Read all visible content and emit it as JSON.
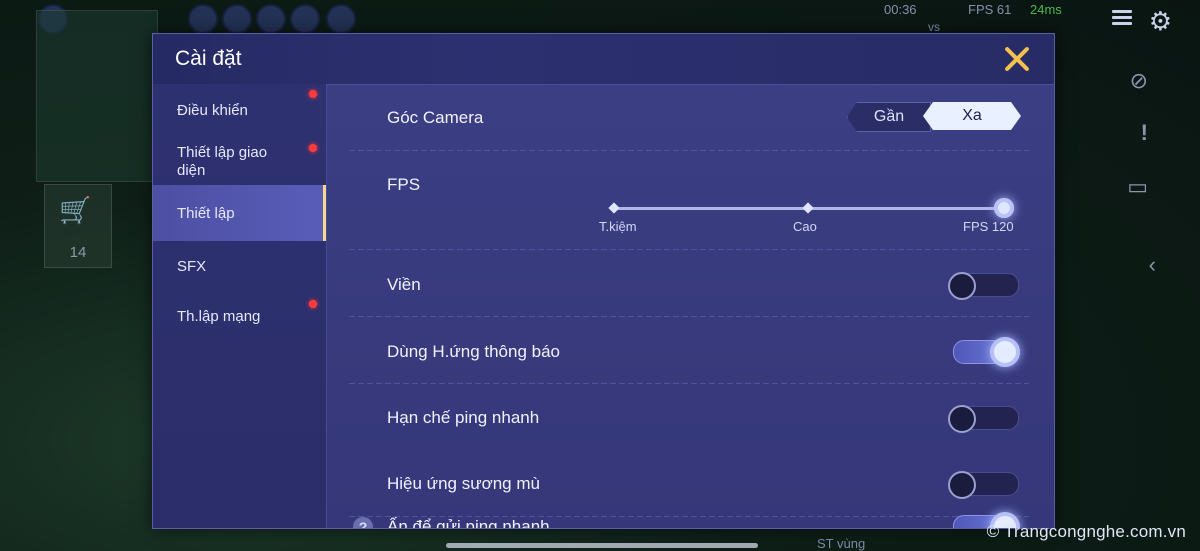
{
  "hud": {
    "timer": "00:36",
    "fps_label": "FPS 61",
    "ping": "24ms",
    "vs": "vs"
  },
  "shop": {
    "count": "14"
  },
  "background": {
    "st_label": "ST vùng"
  },
  "watermark": "© Trangcongnghe.com.vn",
  "dialog": {
    "title": "Cài đặt",
    "close_icon": "close-icon"
  },
  "sidebar": {
    "items": [
      {
        "label": "Điều khiển",
        "badge": true,
        "active": false
      },
      {
        "label": "Thiết lập giao diện",
        "badge": true,
        "active": false
      },
      {
        "label": "Thiết lập",
        "badge": false,
        "active": true
      },
      {
        "label": "SFX",
        "badge": false,
        "active": false
      },
      {
        "label": "Th.lập mạng",
        "badge": true,
        "active": false
      }
    ]
  },
  "settings": {
    "camera": {
      "label": "Góc Camera",
      "options": [
        "Gần",
        "Xa"
      ],
      "selected": "Xa"
    },
    "fps": {
      "label": "FPS",
      "options": [
        "T.kiệm",
        "Cao",
        "FPS 120"
      ],
      "selected": "FPS 120"
    },
    "toggles": [
      {
        "label": "Viền",
        "on": false
      },
      {
        "label": "Dùng H.ứng thông báo",
        "on": true
      },
      {
        "label": "Hạn chế ping nhanh",
        "on": false
      },
      {
        "label": "Hiệu ứng sương mù",
        "on": false
      },
      {
        "label": "Ấn để gửi ping nhanh",
        "on": true
      }
    ]
  },
  "colors": {
    "accent": "#f2c14e",
    "badge": "#ff3b3b",
    "dialog_bg": "#3d3f86"
  }
}
